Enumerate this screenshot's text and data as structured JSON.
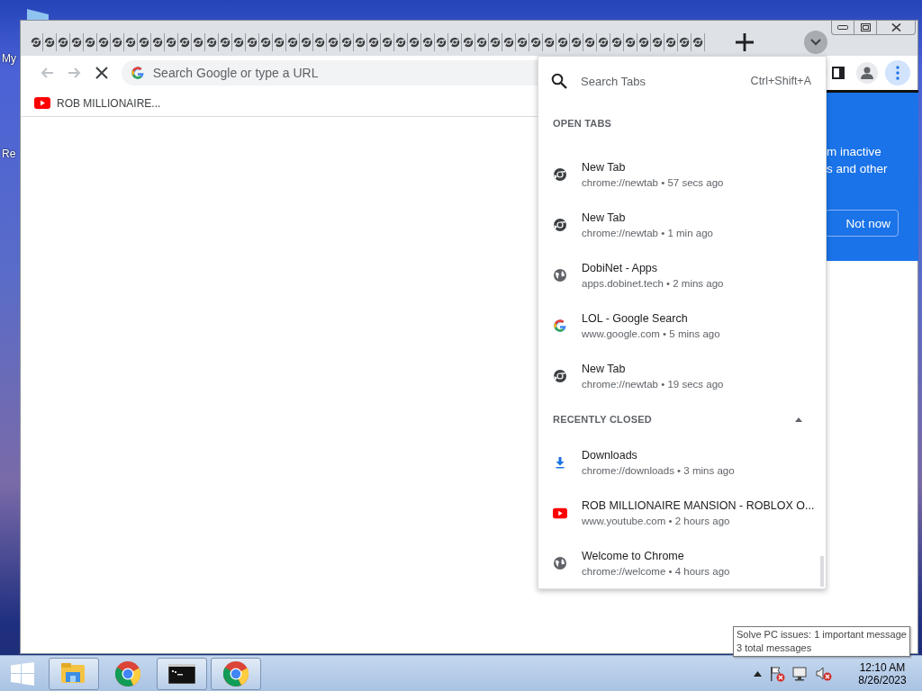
{
  "desktop": {
    "icon_labels": [
      "My",
      "Re"
    ]
  },
  "browser": {
    "tabs": [
      {
        "kind": "chrome"
      },
      {
        "kind": "chrome"
      },
      {
        "kind": "chrome"
      },
      {
        "kind": "chrome"
      },
      {
        "kind": "chrome"
      },
      {
        "kind": "chrome"
      },
      {
        "kind": "chrome"
      },
      {
        "kind": "chrome"
      },
      {
        "kind": "chrome"
      },
      {
        "kind": "chrome"
      },
      {
        "kind": "chrome"
      },
      {
        "kind": "chrome"
      },
      {
        "kind": "chrome"
      },
      {
        "kind": "chrome"
      },
      {
        "kind": "chrome"
      },
      {
        "kind": "chrome"
      },
      {
        "kind": "chrome"
      },
      {
        "kind": "chrome"
      },
      {
        "kind": "chrome"
      },
      {
        "kind": "chrome"
      },
      {
        "kind": "chrome"
      },
      {
        "kind": "chrome"
      },
      {
        "kind": "chrome"
      },
      {
        "kind": "chrome"
      },
      {
        "kind": "chrome"
      },
      {
        "kind": "chrome"
      },
      {
        "kind": "chrome"
      },
      {
        "kind": "chrome"
      },
      {
        "kind": "chrome"
      },
      {
        "kind": "chrome"
      },
      {
        "kind": "chrome"
      },
      {
        "kind": "chrome"
      },
      {
        "kind": "chrome"
      },
      {
        "kind": "chrome"
      },
      {
        "kind": "chrome"
      },
      {
        "kind": "chrome"
      },
      {
        "kind": "chrome"
      },
      {
        "kind": "chrome"
      },
      {
        "kind": "chrome"
      },
      {
        "kind": "chrome"
      },
      {
        "kind": "chrome"
      },
      {
        "kind": "chrome"
      },
      {
        "kind": "chrome"
      },
      {
        "kind": "chrome"
      },
      {
        "kind": "chrome"
      },
      {
        "kind": "chrome"
      },
      {
        "kind": "chrome"
      },
      {
        "kind": "chrome"
      },
      {
        "kind": "chrome"
      },
      {
        "kind": "chrome"
      }
    ],
    "omnibox": {
      "placeholder": "Search Google or type a URL"
    },
    "bookmarks": [
      {
        "title": "ROB MILLIONAIRE...",
        "kind": "youtube"
      }
    ],
    "promo": {
      "lines": [
        "m inactive",
        "s and other"
      ],
      "button": "Not now"
    }
  },
  "tab_search": {
    "placeholder": "Search Tabs",
    "shortcut": "Ctrl+Shift+A",
    "sections": [
      {
        "title": "OPEN TABS",
        "items": [
          {
            "title": "New Tab",
            "subtitle": "chrome://newtab • 57 secs ago",
            "kind": "chrome"
          },
          {
            "title": "New Tab",
            "subtitle": "chrome://newtab • 1 min ago",
            "kind": "chrome"
          },
          {
            "title": "DobiNet - Apps",
            "subtitle": "apps.dobinet.tech • 2 mins ago",
            "kind": "globe"
          },
          {
            "title": "LOL - Google Search",
            "subtitle": "www.google.com • 5 mins ago",
            "kind": "google"
          },
          {
            "title": "New Tab",
            "subtitle": "chrome://newtab • 19 secs ago",
            "kind": "chrome"
          }
        ]
      },
      {
        "title": "RECENTLY CLOSED",
        "expanded": true,
        "items": [
          {
            "title": "Downloads",
            "subtitle": "chrome://downloads • 3 mins ago",
            "kind": "download"
          },
          {
            "title": "ROB MILLIONAIRE MANSION - ROBLOX O...",
            "subtitle": "www.youtube.com • 2 hours ago",
            "kind": "youtube"
          },
          {
            "title": "Welcome to Chrome",
            "subtitle": "chrome://welcome • 4 hours ago",
            "kind": "globe"
          }
        ]
      }
    ]
  },
  "tooltip": {
    "lines": [
      "Solve PC issues: 1 important message",
      "3 total messages"
    ]
  },
  "taskbar": {
    "apps": [
      {
        "kind": "explorer",
        "running": true
      },
      {
        "kind": "chrome",
        "running": false
      },
      {
        "kind": "terminal",
        "running": true
      },
      {
        "kind": "chrome",
        "running": true
      }
    ],
    "clock": {
      "time": "12:10 AM",
      "date": "8/26/2023"
    }
  }
}
